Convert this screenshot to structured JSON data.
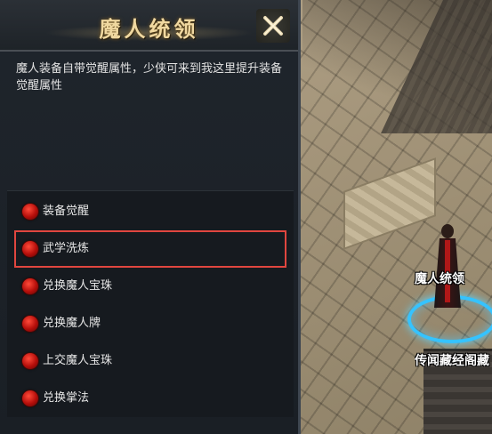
{
  "dialog": {
    "title": "魔人统领",
    "description": "魔人装备自带觉醒属性，少侠可来到我这里提升装备觉醒属性",
    "options": [
      {
        "label": "装备觉醒",
        "selected": false
      },
      {
        "label": "武学洗炼",
        "selected": true
      },
      {
        "label": "兑换魔人宝珠",
        "selected": false
      },
      {
        "label": "兑换魔人牌",
        "selected": false
      },
      {
        "label": "上交魔人宝珠",
        "selected": false
      },
      {
        "label": "兑换掌法",
        "selected": false
      }
    ],
    "close_icon": "close-x-icon"
  },
  "world": {
    "npc_name": "魔人统领",
    "sign_text": "传闻藏经阁藏"
  },
  "colors": {
    "title": "#f0d8a0",
    "highlight": "#e0463f",
    "option_dot": "#c0120c",
    "npc_ring": "#35c3ff"
  }
}
